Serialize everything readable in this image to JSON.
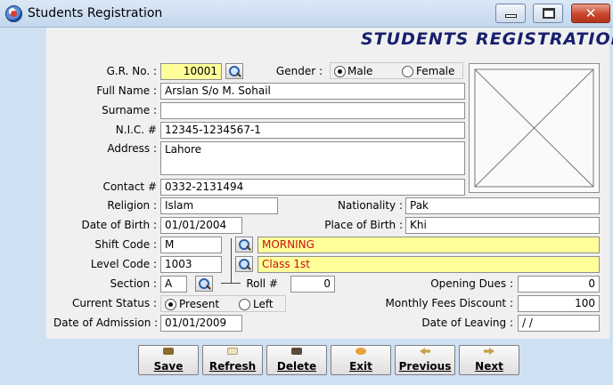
{
  "window": {
    "title": "Students Registration",
    "close_glyph": "✕"
  },
  "heading": "STUDENTS REGISTRATION",
  "labels": {
    "gr_no": "G.R. No. :",
    "gender": "Gender :",
    "full_name": "Full Name :",
    "surname": "Surname :",
    "nic": "N.I.C. #",
    "address": "Address :",
    "contact": "Contact #",
    "religion": "Religion :",
    "nationality": "Nationality :",
    "dob": "Date of Birth :",
    "place_of_birth": "Place of Birth :",
    "shift_code": "Shift Code :",
    "level_code": "Level Code :",
    "section": "Section :",
    "roll": "Roll #",
    "opening_dues": "Opening Dues :",
    "current_status": "Current Status :",
    "monthly_fees_discount": "Monthly Fees Discount :",
    "date_of_admission": "Date of Admission :",
    "date_of_leaving": "Date of Leaving :"
  },
  "gender": {
    "options": [
      "Male",
      "Female"
    ],
    "selected": "Male"
  },
  "current_status": {
    "options": [
      "Present",
      "Left"
    ],
    "selected": "Present"
  },
  "values": {
    "gr_no": "10001",
    "full_name": "Arslan S/o M. Sohail",
    "surname": "",
    "nic": "12345-1234567-1",
    "address": "Lahore",
    "contact": "0332-2131494",
    "religion": "Islam",
    "nationality": "Pak",
    "dob": "01/01/2004",
    "place_of_birth": "Khi",
    "shift_code": "M",
    "shift_name": "MORNING",
    "level_code": "1003",
    "level_name": "Class 1st",
    "section": "A",
    "roll": "0",
    "opening_dues": "0",
    "monthly_fees_discount": "100",
    "date_of_admission": "01/01/2009",
    "date_of_leaving": " / /"
  },
  "buttons": {
    "save": "Save",
    "refresh": "Refresh",
    "delete": "Delete",
    "exit": "Exit",
    "previous": "Previous",
    "next": "Next"
  },
  "icons": [
    "app-icon",
    "search-icon",
    "photo-placeholder-icon",
    "save-icon",
    "refresh-icon",
    "delete-icon",
    "exit-icon",
    "previous-icon",
    "next-icon"
  ],
  "colors": {
    "highlight": "#ffff99",
    "heading": "#17206e",
    "lookup_text": "#c81010",
    "panel": "#f0f0f0",
    "frame": "#cfe0f2"
  }
}
